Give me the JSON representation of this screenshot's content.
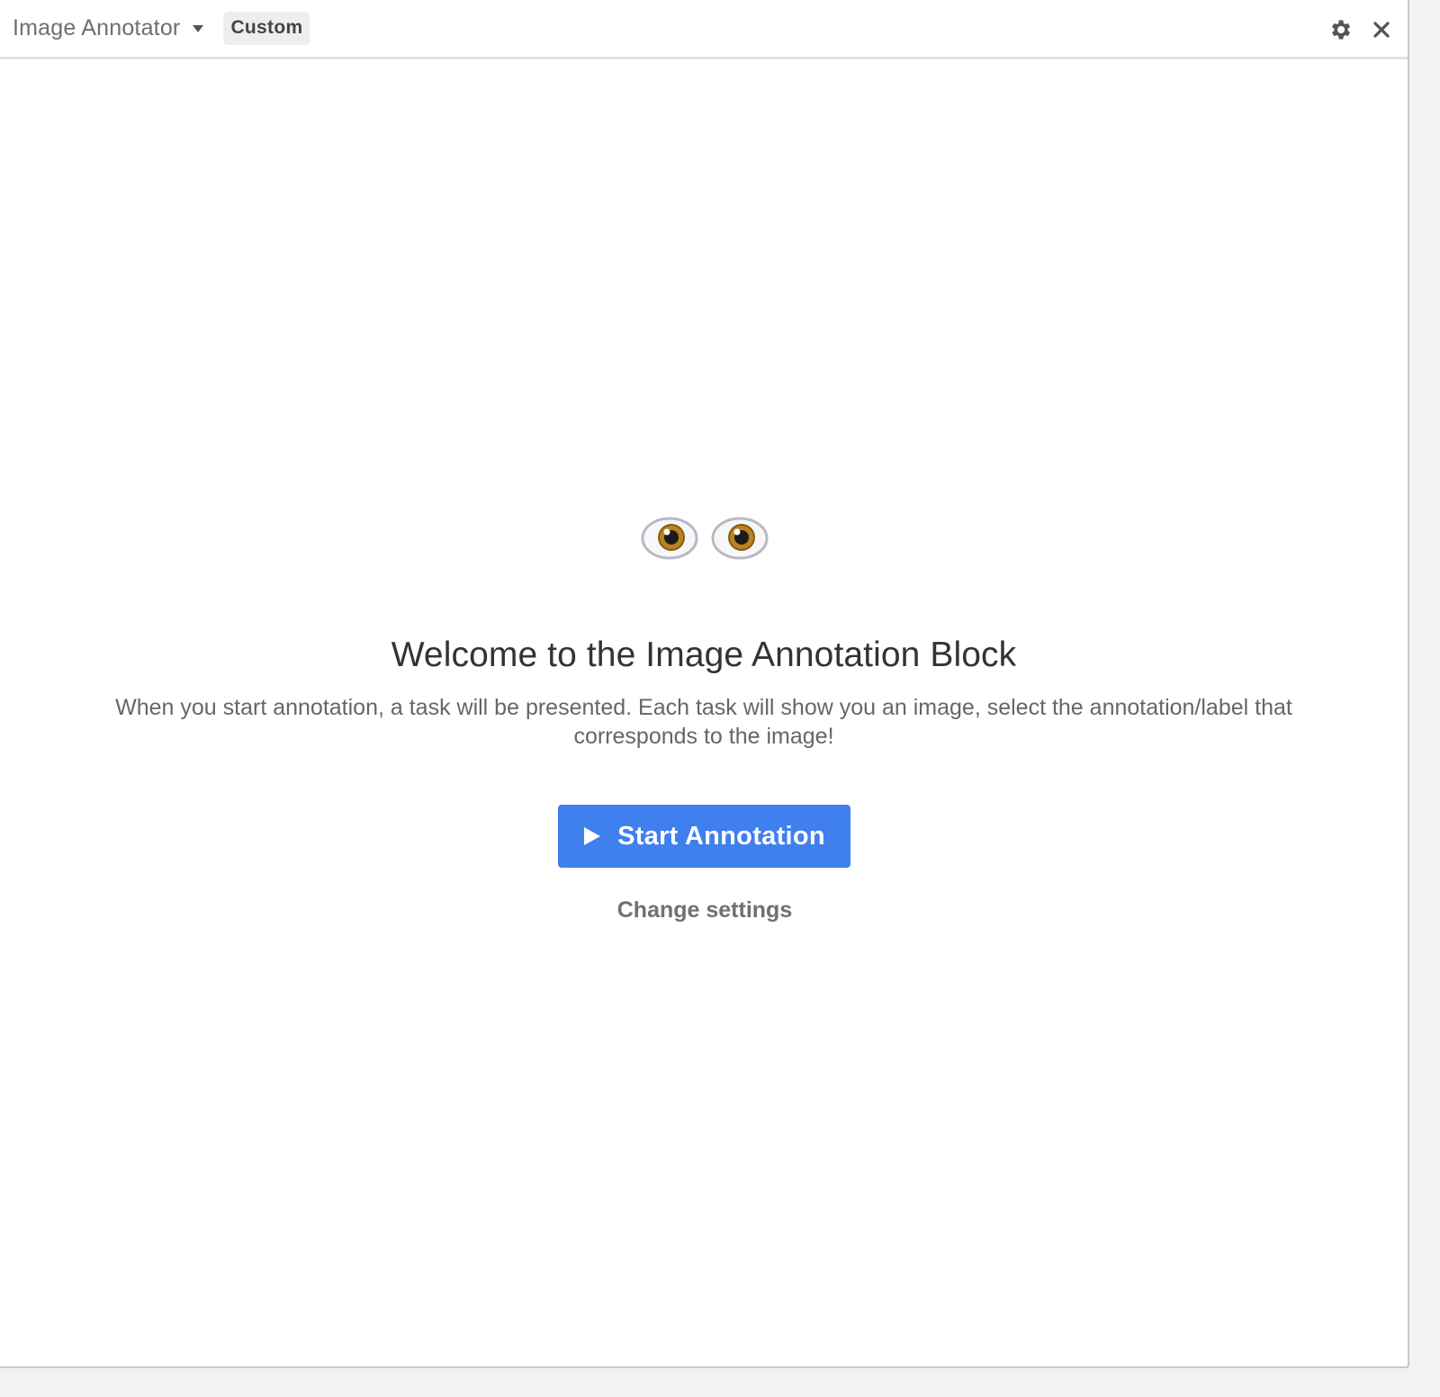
{
  "header": {
    "block_name": "Image Annotator",
    "badge": "Custom",
    "icons": [
      "chevron-down-icon",
      "gear-icon",
      "close-icon"
    ]
  },
  "main": {
    "emoji": "👀",
    "headline": "Welcome to the Image Annotation Block",
    "description": "When you start annotation, a task will be presented. Each task will show you an image, select the annotation/label that corresponds to the image!",
    "start_button_label": "Start Annotation",
    "settings_link": "Change settings"
  },
  "colors": {
    "accent": "#3f7fee",
    "text_primary": "#333333",
    "text_secondary": "#666666"
  }
}
